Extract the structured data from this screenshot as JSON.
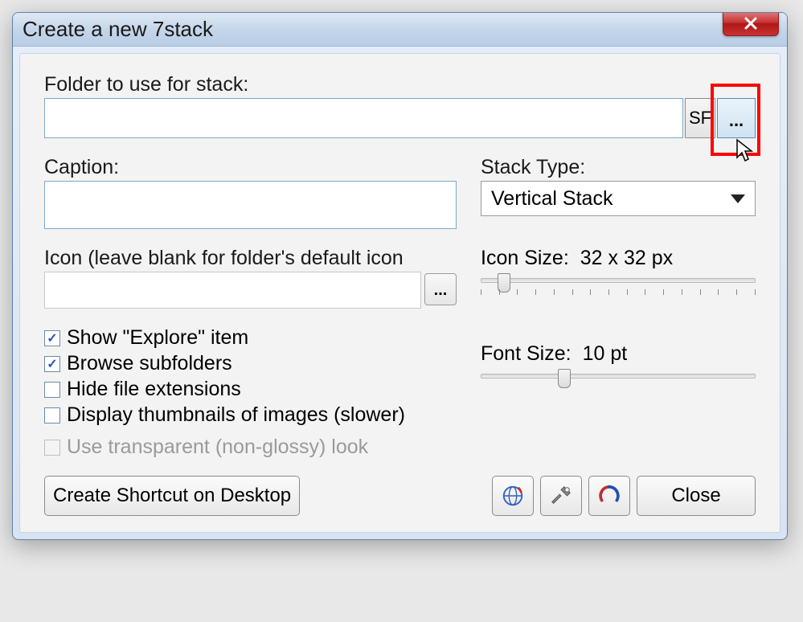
{
  "title": "Create a new 7stack",
  "labels": {
    "folder": "Folder to use for stack:",
    "caption": "Caption:",
    "stackType": "Stack Type:",
    "icon": "Icon (leave blank for folder's default icon",
    "iconSize": "Icon Size:",
    "fontSize": "Font Size:"
  },
  "values": {
    "folder": "",
    "caption": "",
    "stackType": "Vertical Stack",
    "iconSize": "32 x 32 px",
    "fontSize": "10 pt"
  },
  "buttons": {
    "sf": "SF",
    "browse": "...",
    "iconBrowse": "...",
    "createShortcut": "Create Shortcut on Desktop",
    "close": "Close"
  },
  "checkboxes": {
    "showExplore": {
      "label": "Show \"Explore\" item",
      "checked": true
    },
    "browseSubfolders": {
      "label": "Browse subfolders",
      "checked": true
    },
    "hideExtensions": {
      "label": "Hide file extensions",
      "checked": false
    },
    "thumbnails": {
      "label": "Display thumbnails of images (slower)",
      "checked": false
    },
    "transparent": {
      "label": "Use transparent (non-glossy) look",
      "checked": false,
      "disabled": true
    }
  },
  "sliders": {
    "iconSize": {
      "position": 6
    },
    "fontSize": {
      "position": 28
    }
  }
}
